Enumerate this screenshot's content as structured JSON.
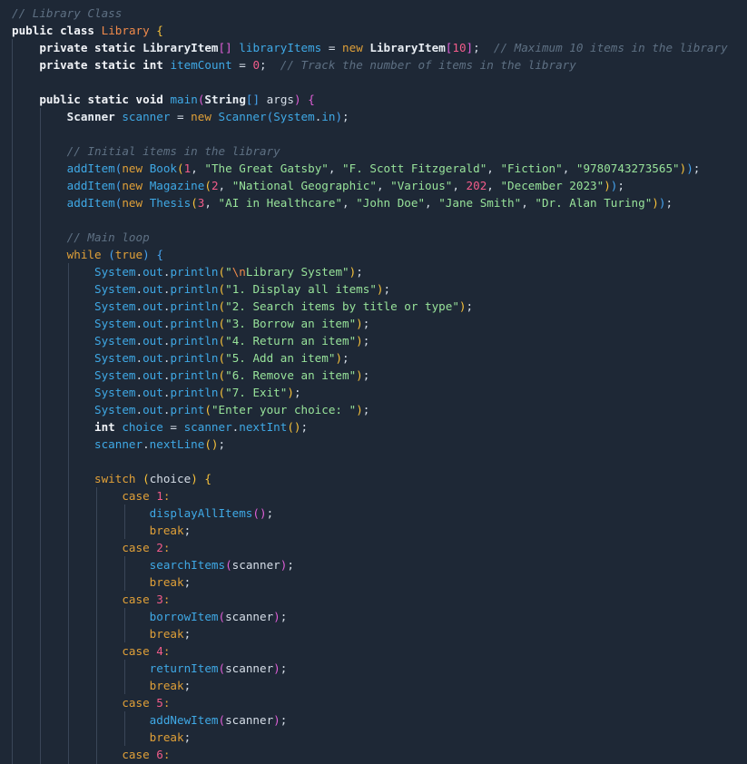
{
  "editor": {
    "language": "Java",
    "theme_background": "#1e2836",
    "lines": [
      [
        [
          "cm",
          "// Library Class"
        ]
      ],
      [
        [
          "kw",
          "public"
        ],
        [
          "op",
          " "
        ],
        [
          "kw",
          "class"
        ],
        [
          "op",
          " "
        ],
        [
          "cls2",
          "Library"
        ],
        [
          "op",
          " "
        ],
        [
          "br1",
          "{"
        ]
      ],
      [
        [
          "op",
          "    "
        ],
        [
          "kw",
          "private"
        ],
        [
          "op",
          " "
        ],
        [
          "kw",
          "static"
        ],
        [
          "op",
          " "
        ],
        [
          "cls",
          "LibraryItem"
        ],
        [
          "br2",
          "[]"
        ],
        [
          "op",
          " "
        ],
        [
          "var",
          "libraryItems"
        ],
        [
          "op",
          " = "
        ],
        [
          "kw2",
          "new"
        ],
        [
          "op",
          " "
        ],
        [
          "cls",
          "LibraryItem"
        ],
        [
          "br2",
          "["
        ],
        [
          "num",
          "10"
        ],
        [
          "br2",
          "]"
        ],
        [
          "op",
          ";  "
        ],
        [
          "cm",
          "// Maximum 10 items in the library"
        ]
      ],
      [
        [
          "op",
          "    "
        ],
        [
          "kw",
          "private"
        ],
        [
          "op",
          " "
        ],
        [
          "kw",
          "static"
        ],
        [
          "op",
          " "
        ],
        [
          "kw",
          "int"
        ],
        [
          "op",
          " "
        ],
        [
          "var",
          "itemCount"
        ],
        [
          "op",
          " = "
        ],
        [
          "num",
          "0"
        ],
        [
          "op",
          ";  "
        ],
        [
          "cm",
          "// Track the number of items in the library"
        ]
      ],
      [],
      [
        [
          "op",
          "    "
        ],
        [
          "kw",
          "public"
        ],
        [
          "op",
          " "
        ],
        [
          "kw",
          "static"
        ],
        [
          "op",
          " "
        ],
        [
          "kw",
          "void"
        ],
        [
          "op",
          " "
        ],
        [
          "fn",
          "main"
        ],
        [
          "br2",
          "("
        ],
        [
          "cls",
          "String"
        ],
        [
          "br3",
          "[]"
        ],
        [
          "op",
          " args"
        ],
        [
          "br2",
          ")"
        ],
        [
          "op",
          " "
        ],
        [
          "br2",
          "{"
        ]
      ],
      [
        [
          "op",
          "        "
        ],
        [
          "cls",
          "Scanner"
        ],
        [
          "op",
          " "
        ],
        [
          "var",
          "scanner"
        ],
        [
          "op",
          " = "
        ],
        [
          "kw2",
          "new"
        ],
        [
          "op",
          " "
        ],
        [
          "fn",
          "Scanner"
        ],
        [
          "br3",
          "("
        ],
        [
          "obj",
          "System"
        ],
        [
          "op",
          "."
        ],
        [
          "var",
          "in"
        ],
        [
          "br3",
          ")"
        ],
        [
          "op",
          ";"
        ]
      ],
      [],
      [
        [
          "op",
          "        "
        ],
        [
          "cm",
          "// Initial items in the library"
        ]
      ],
      [
        [
          "op",
          "        "
        ],
        [
          "fn",
          "addItem"
        ],
        [
          "br3",
          "("
        ],
        [
          "kw2",
          "new"
        ],
        [
          "op",
          " "
        ],
        [
          "fn",
          "Book"
        ],
        [
          "br1",
          "("
        ],
        [
          "num",
          "1"
        ],
        [
          "op",
          ", "
        ],
        [
          "str",
          "\"The Great Gatsby\""
        ],
        [
          "op",
          ", "
        ],
        [
          "str",
          "\"F. Scott Fitzgerald\""
        ],
        [
          "op",
          ", "
        ],
        [
          "str",
          "\"Fiction\""
        ],
        [
          "op",
          ", "
        ],
        [
          "str",
          "\"9780743273565\""
        ],
        [
          "br1",
          ")"
        ],
        [
          "br3",
          ")"
        ],
        [
          "op",
          ";"
        ]
      ],
      [
        [
          "op",
          "        "
        ],
        [
          "fn",
          "addItem"
        ],
        [
          "br3",
          "("
        ],
        [
          "kw2",
          "new"
        ],
        [
          "op",
          " "
        ],
        [
          "fn",
          "Magazine"
        ],
        [
          "br1",
          "("
        ],
        [
          "num",
          "2"
        ],
        [
          "op",
          ", "
        ],
        [
          "str",
          "\"National Geographic\""
        ],
        [
          "op",
          ", "
        ],
        [
          "str",
          "\"Various\""
        ],
        [
          "op",
          ", "
        ],
        [
          "num",
          "202"
        ],
        [
          "op",
          ", "
        ],
        [
          "str",
          "\"December 2023\""
        ],
        [
          "br1",
          ")"
        ],
        [
          "br3",
          ")"
        ],
        [
          "op",
          ";"
        ]
      ],
      [
        [
          "op",
          "        "
        ],
        [
          "fn",
          "addItem"
        ],
        [
          "br3",
          "("
        ],
        [
          "kw2",
          "new"
        ],
        [
          "op",
          " "
        ],
        [
          "fn",
          "Thesis"
        ],
        [
          "br1",
          "("
        ],
        [
          "num",
          "3"
        ],
        [
          "op",
          ", "
        ],
        [
          "str",
          "\"AI in Healthcare\""
        ],
        [
          "op",
          ", "
        ],
        [
          "str",
          "\"John Doe\""
        ],
        [
          "op",
          ", "
        ],
        [
          "str",
          "\"Jane Smith\""
        ],
        [
          "op",
          ", "
        ],
        [
          "str",
          "\"Dr. Alan Turing\""
        ],
        [
          "br1",
          ")"
        ],
        [
          "br3",
          ")"
        ],
        [
          "op",
          ";"
        ]
      ],
      [],
      [
        [
          "op",
          "        "
        ],
        [
          "cm",
          "// Main loop"
        ]
      ],
      [
        [
          "op",
          "        "
        ],
        [
          "kw2",
          "while"
        ],
        [
          "op",
          " "
        ],
        [
          "br3",
          "("
        ],
        [
          "kw2",
          "true"
        ],
        [
          "br3",
          ")"
        ],
        [
          "op",
          " "
        ],
        [
          "br3",
          "{"
        ]
      ],
      [
        [
          "op",
          "            "
        ],
        [
          "obj",
          "System"
        ],
        [
          "op",
          "."
        ],
        [
          "var",
          "out"
        ],
        [
          "op",
          "."
        ],
        [
          "fn",
          "println"
        ],
        [
          "br1",
          "("
        ],
        [
          "str",
          "\""
        ],
        [
          "esc",
          "\\n"
        ],
        [
          "str",
          "Library System\""
        ],
        [
          "br1",
          ")"
        ],
        [
          "op",
          ";"
        ]
      ],
      [
        [
          "op",
          "            "
        ],
        [
          "obj",
          "System"
        ],
        [
          "op",
          "."
        ],
        [
          "var",
          "out"
        ],
        [
          "op",
          "."
        ],
        [
          "fn",
          "println"
        ],
        [
          "br1",
          "("
        ],
        [
          "str",
          "\"1. Display all items\""
        ],
        [
          "br1",
          ")"
        ],
        [
          "op",
          ";"
        ]
      ],
      [
        [
          "op",
          "            "
        ],
        [
          "obj",
          "System"
        ],
        [
          "op",
          "."
        ],
        [
          "var",
          "out"
        ],
        [
          "op",
          "."
        ],
        [
          "fn",
          "println"
        ],
        [
          "br1",
          "("
        ],
        [
          "str",
          "\"2. Search items by title or type\""
        ],
        [
          "br1",
          ")"
        ],
        [
          "op",
          ";"
        ]
      ],
      [
        [
          "op",
          "            "
        ],
        [
          "obj",
          "System"
        ],
        [
          "op",
          "."
        ],
        [
          "var",
          "out"
        ],
        [
          "op",
          "."
        ],
        [
          "fn",
          "println"
        ],
        [
          "br1",
          "("
        ],
        [
          "str",
          "\"3. Borrow an item\""
        ],
        [
          "br1",
          ")"
        ],
        [
          "op",
          ";"
        ]
      ],
      [
        [
          "op",
          "            "
        ],
        [
          "obj",
          "System"
        ],
        [
          "op",
          "."
        ],
        [
          "var",
          "out"
        ],
        [
          "op",
          "."
        ],
        [
          "fn",
          "println"
        ],
        [
          "br1",
          "("
        ],
        [
          "str",
          "\"4. Return an item\""
        ],
        [
          "br1",
          ")"
        ],
        [
          "op",
          ";"
        ]
      ],
      [
        [
          "op",
          "            "
        ],
        [
          "obj",
          "System"
        ],
        [
          "op",
          "."
        ],
        [
          "var",
          "out"
        ],
        [
          "op",
          "."
        ],
        [
          "fn",
          "println"
        ],
        [
          "br1",
          "("
        ],
        [
          "str",
          "\"5. Add an item\""
        ],
        [
          "br1",
          ")"
        ],
        [
          "op",
          ";"
        ]
      ],
      [
        [
          "op",
          "            "
        ],
        [
          "obj",
          "System"
        ],
        [
          "op",
          "."
        ],
        [
          "var",
          "out"
        ],
        [
          "op",
          "."
        ],
        [
          "fn",
          "println"
        ],
        [
          "br1",
          "("
        ],
        [
          "str",
          "\"6. Remove an item\""
        ],
        [
          "br1",
          ")"
        ],
        [
          "op",
          ";"
        ]
      ],
      [
        [
          "op",
          "            "
        ],
        [
          "obj",
          "System"
        ],
        [
          "op",
          "."
        ],
        [
          "var",
          "out"
        ],
        [
          "op",
          "."
        ],
        [
          "fn",
          "println"
        ],
        [
          "br1",
          "("
        ],
        [
          "str",
          "\"7. Exit\""
        ],
        [
          "br1",
          ")"
        ],
        [
          "op",
          ";"
        ]
      ],
      [
        [
          "op",
          "            "
        ],
        [
          "obj",
          "System"
        ],
        [
          "op",
          "."
        ],
        [
          "var",
          "out"
        ],
        [
          "op",
          "."
        ],
        [
          "fn",
          "print"
        ],
        [
          "br1",
          "("
        ],
        [
          "str",
          "\"Enter your choice: \""
        ],
        [
          "br1",
          ")"
        ],
        [
          "op",
          ";"
        ]
      ],
      [
        [
          "op",
          "            "
        ],
        [
          "kw",
          "int"
        ],
        [
          "op",
          " "
        ],
        [
          "var",
          "choice"
        ],
        [
          "op",
          " = "
        ],
        [
          "var",
          "scanner"
        ],
        [
          "op",
          "."
        ],
        [
          "fn",
          "nextInt"
        ],
        [
          "br1",
          "()"
        ],
        [
          "op",
          ";"
        ]
      ],
      [
        [
          "op",
          "            "
        ],
        [
          "var",
          "scanner"
        ],
        [
          "op",
          "."
        ],
        [
          "fn",
          "nextLine"
        ],
        [
          "br1",
          "()"
        ],
        [
          "op",
          ";"
        ]
      ],
      [],
      [
        [
          "op",
          "            "
        ],
        [
          "kw2",
          "switch"
        ],
        [
          "op",
          " "
        ],
        [
          "br1",
          "("
        ],
        [
          "op",
          "choice"
        ],
        [
          "br1",
          ")"
        ],
        [
          "op",
          " "
        ],
        [
          "br1",
          "{"
        ]
      ],
      [
        [
          "op",
          "                "
        ],
        [
          "kw2",
          "case"
        ],
        [
          "op",
          " "
        ],
        [
          "num",
          "1"
        ],
        [
          "kw2",
          ":"
        ]
      ],
      [
        [
          "op",
          "                    "
        ],
        [
          "fn",
          "displayAllItems"
        ],
        [
          "br2",
          "()"
        ],
        [
          "op",
          ";"
        ]
      ],
      [
        [
          "op",
          "                    "
        ],
        [
          "kw2",
          "break"
        ],
        [
          "op",
          ";"
        ]
      ],
      [
        [
          "op",
          "                "
        ],
        [
          "kw2",
          "case"
        ],
        [
          "op",
          " "
        ],
        [
          "num",
          "2"
        ],
        [
          "kw2",
          ":"
        ]
      ],
      [
        [
          "op",
          "                    "
        ],
        [
          "fn",
          "searchItems"
        ],
        [
          "br2",
          "("
        ],
        [
          "op",
          "scanner"
        ],
        [
          "br2",
          ")"
        ],
        [
          "op",
          ";"
        ]
      ],
      [
        [
          "op",
          "                    "
        ],
        [
          "kw2",
          "break"
        ],
        [
          "op",
          ";"
        ]
      ],
      [
        [
          "op",
          "                "
        ],
        [
          "kw2",
          "case"
        ],
        [
          "op",
          " "
        ],
        [
          "num",
          "3"
        ],
        [
          "kw2",
          ":"
        ]
      ],
      [
        [
          "op",
          "                    "
        ],
        [
          "fn",
          "borrowItem"
        ],
        [
          "br2",
          "("
        ],
        [
          "op",
          "scanner"
        ],
        [
          "br2",
          ")"
        ],
        [
          "op",
          ";"
        ]
      ],
      [
        [
          "op",
          "                    "
        ],
        [
          "kw2",
          "break"
        ],
        [
          "op",
          ";"
        ]
      ],
      [
        [
          "op",
          "                "
        ],
        [
          "kw2",
          "case"
        ],
        [
          "op",
          " "
        ],
        [
          "num",
          "4"
        ],
        [
          "kw2",
          ":"
        ]
      ],
      [
        [
          "op",
          "                    "
        ],
        [
          "fn",
          "returnItem"
        ],
        [
          "br2",
          "("
        ],
        [
          "op",
          "scanner"
        ],
        [
          "br2",
          ")"
        ],
        [
          "op",
          ";"
        ]
      ],
      [
        [
          "op",
          "                    "
        ],
        [
          "kw2",
          "break"
        ],
        [
          "op",
          ";"
        ]
      ],
      [
        [
          "op",
          "                "
        ],
        [
          "kw2",
          "case"
        ],
        [
          "op",
          " "
        ],
        [
          "num",
          "5"
        ],
        [
          "kw2",
          ":"
        ]
      ],
      [
        [
          "op",
          "                    "
        ],
        [
          "fn",
          "addNewItem"
        ],
        [
          "br2",
          "("
        ],
        [
          "op",
          "scanner"
        ],
        [
          "br2",
          ")"
        ],
        [
          "op",
          ";"
        ]
      ],
      [
        [
          "op",
          "                    "
        ],
        [
          "kw2",
          "break"
        ],
        [
          "op",
          ";"
        ]
      ],
      [
        [
          "op",
          "                "
        ],
        [
          "kw2",
          "case"
        ],
        [
          "op",
          " "
        ],
        [
          "num",
          "6"
        ],
        [
          "kw2",
          ":"
        ]
      ]
    ]
  }
}
